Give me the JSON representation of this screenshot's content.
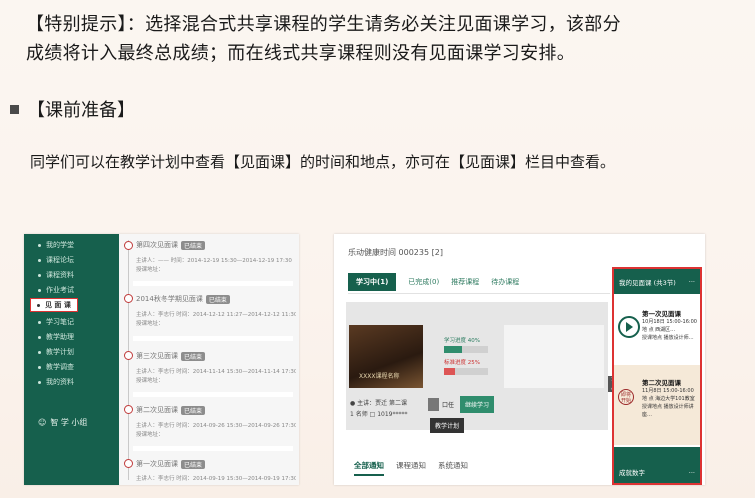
{
  "tip": {
    "line1": "【特别提示】：选择混合式共享课程的学生请务必关注见面课学习，该部分",
    "line2": "成绩将计入最终总成绩；而在线式共享课程则没有见面课学习安排。"
  },
  "section": {
    "title": "【课前准备】"
  },
  "body": {
    "text": "同学们可以在教学计划中查看【见面课】的时间和地点，亦可在【见面课】栏目中查看。"
  },
  "left_screenshot": {
    "sidebar": [
      {
        "label": "我的学堂"
      },
      {
        "label": "课程论坛"
      },
      {
        "label": "课程资料"
      },
      {
        "label": "作业考试"
      },
      {
        "label": "见 面 课",
        "active": true
      },
      {
        "label": "学习笔记"
      },
      {
        "label": "教学助理"
      },
      {
        "label": "教学计划"
      },
      {
        "label": "教学调查"
      },
      {
        "label": "我的资料"
      }
    ],
    "team_label": "智 学 小组",
    "sessions": [
      {
        "title": "第四次见面课",
        "badge": "已结束",
        "meta": "主讲人：—— 时间：2014-12-19 15:30—2014-12-19 17:30",
        "place": "授课地址："
      },
      {
        "title": "2014秋冬学期见面课",
        "badge": "已结束",
        "meta": "主讲人：李志行 时间：2014-12-12 11:27—2014-12-12 11:30",
        "place": "授课地址："
      },
      {
        "title": "第三次见面课",
        "badge": "已结束",
        "meta": "主讲人：李志行 时间：2014-11-14 15:30—2014-11-14 17:30",
        "place": "授课地址："
      },
      {
        "title": "第二次见面课",
        "badge": "已结束",
        "meta": "主讲人：李志行 时间：2014-09-26 15:30—2014-09-26 17:30",
        "place": "授课地址："
      },
      {
        "title": "第一次见面课",
        "badge": "已结束",
        "meta": "主讲人：李志行 时间：2014-09-19 15:30—2014-09-19 17:30",
        "place": ""
      }
    ]
  },
  "right_screenshot": {
    "header": "乐动健康时间 000235 [2]",
    "tabs": [
      "学习中(1)",
      "已完成(0)",
      "推荐课程",
      "待办课程"
    ],
    "course": {
      "cover_text": "XXXX课程名称",
      "teacher": "● 主讲：贾迁 第二课",
      "students": "1 名师 □ 1019*****",
      "progress_label": "学习进度 40%",
      "progress": 0.4,
      "score_label": "标准进度 25%",
      "score_progress": 0.25,
      "tool_label": "口任",
      "continue_button": "继续学习",
      "tooltip": "教学计划",
      "side_mark": "1月"
    },
    "bottom_tabs": [
      "全部通知",
      "课程通知",
      "系统通知"
    ],
    "meeting_panel": {
      "header": "我的见面课 (共3节)",
      "more": "···",
      "card1": {
        "title": "第一次见面课",
        "line1": "10月18日 15:00-16:00",
        "line2": "地 点 西湖区…",
        "line3": "授课地点 播放设计师…"
      },
      "card2": {
        "state": "即将开始",
        "title": "第二次见面课",
        "line1": "11月8日 15:00-16:00",
        "line2": "地 点 海边大学101教室",
        "line3": "授课地点 播放设计师讲座…"
      },
      "footer": "成就数字",
      "footer_more": "···"
    }
  },
  "colors": {
    "brand_green": "#16604d",
    "highlight_red": "#dd3333"
  }
}
